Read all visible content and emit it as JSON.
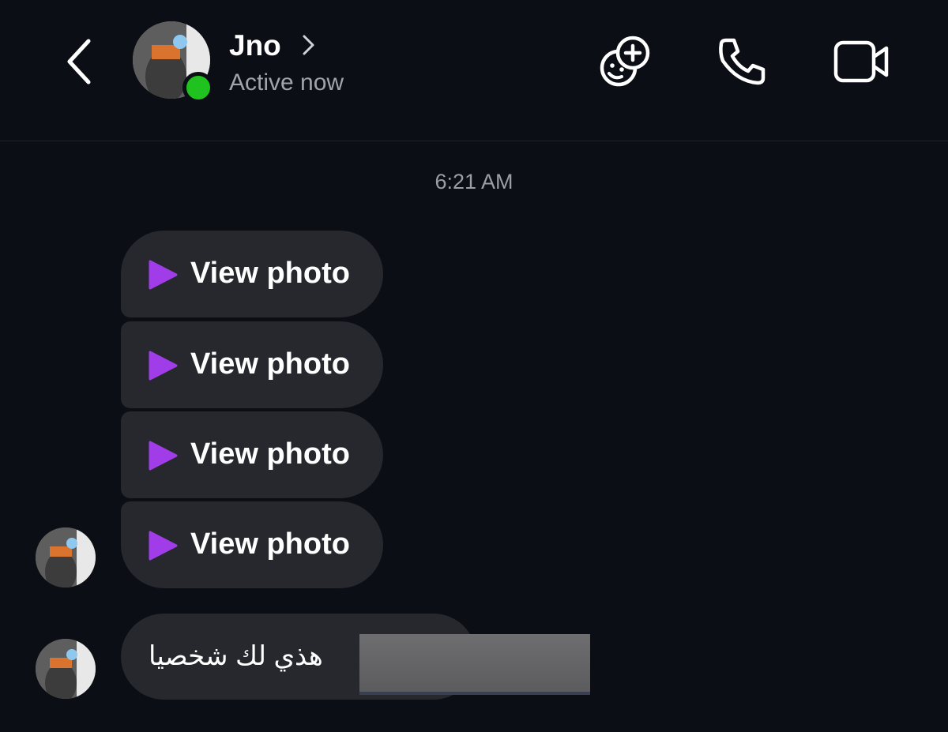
{
  "header": {
    "contact_name": "Jno",
    "status": "Active now",
    "icons": {
      "back": "chevron-left-icon",
      "name_chevron": "chevron-right-icon",
      "effects": "effects-add-icon",
      "call": "phone-icon",
      "video": "video-camera-icon"
    },
    "online_color": "#1fc21f"
  },
  "thread": {
    "timestamp": "6:21 AM",
    "messages": [
      {
        "type": "photo",
        "label": "View photo"
      },
      {
        "type": "photo",
        "label": "View photo"
      },
      {
        "type": "photo",
        "label": "View photo"
      },
      {
        "type": "photo",
        "label": "View photo"
      },
      {
        "type": "text",
        "text": "هذي لك شخصيا"
      }
    ],
    "play_icon": "play-icon",
    "play_color": "#a13de8",
    "bubble_color": "#26282e"
  },
  "theme": {
    "background": "#0b0e14",
    "secondary_text": "#a0a4ab"
  }
}
